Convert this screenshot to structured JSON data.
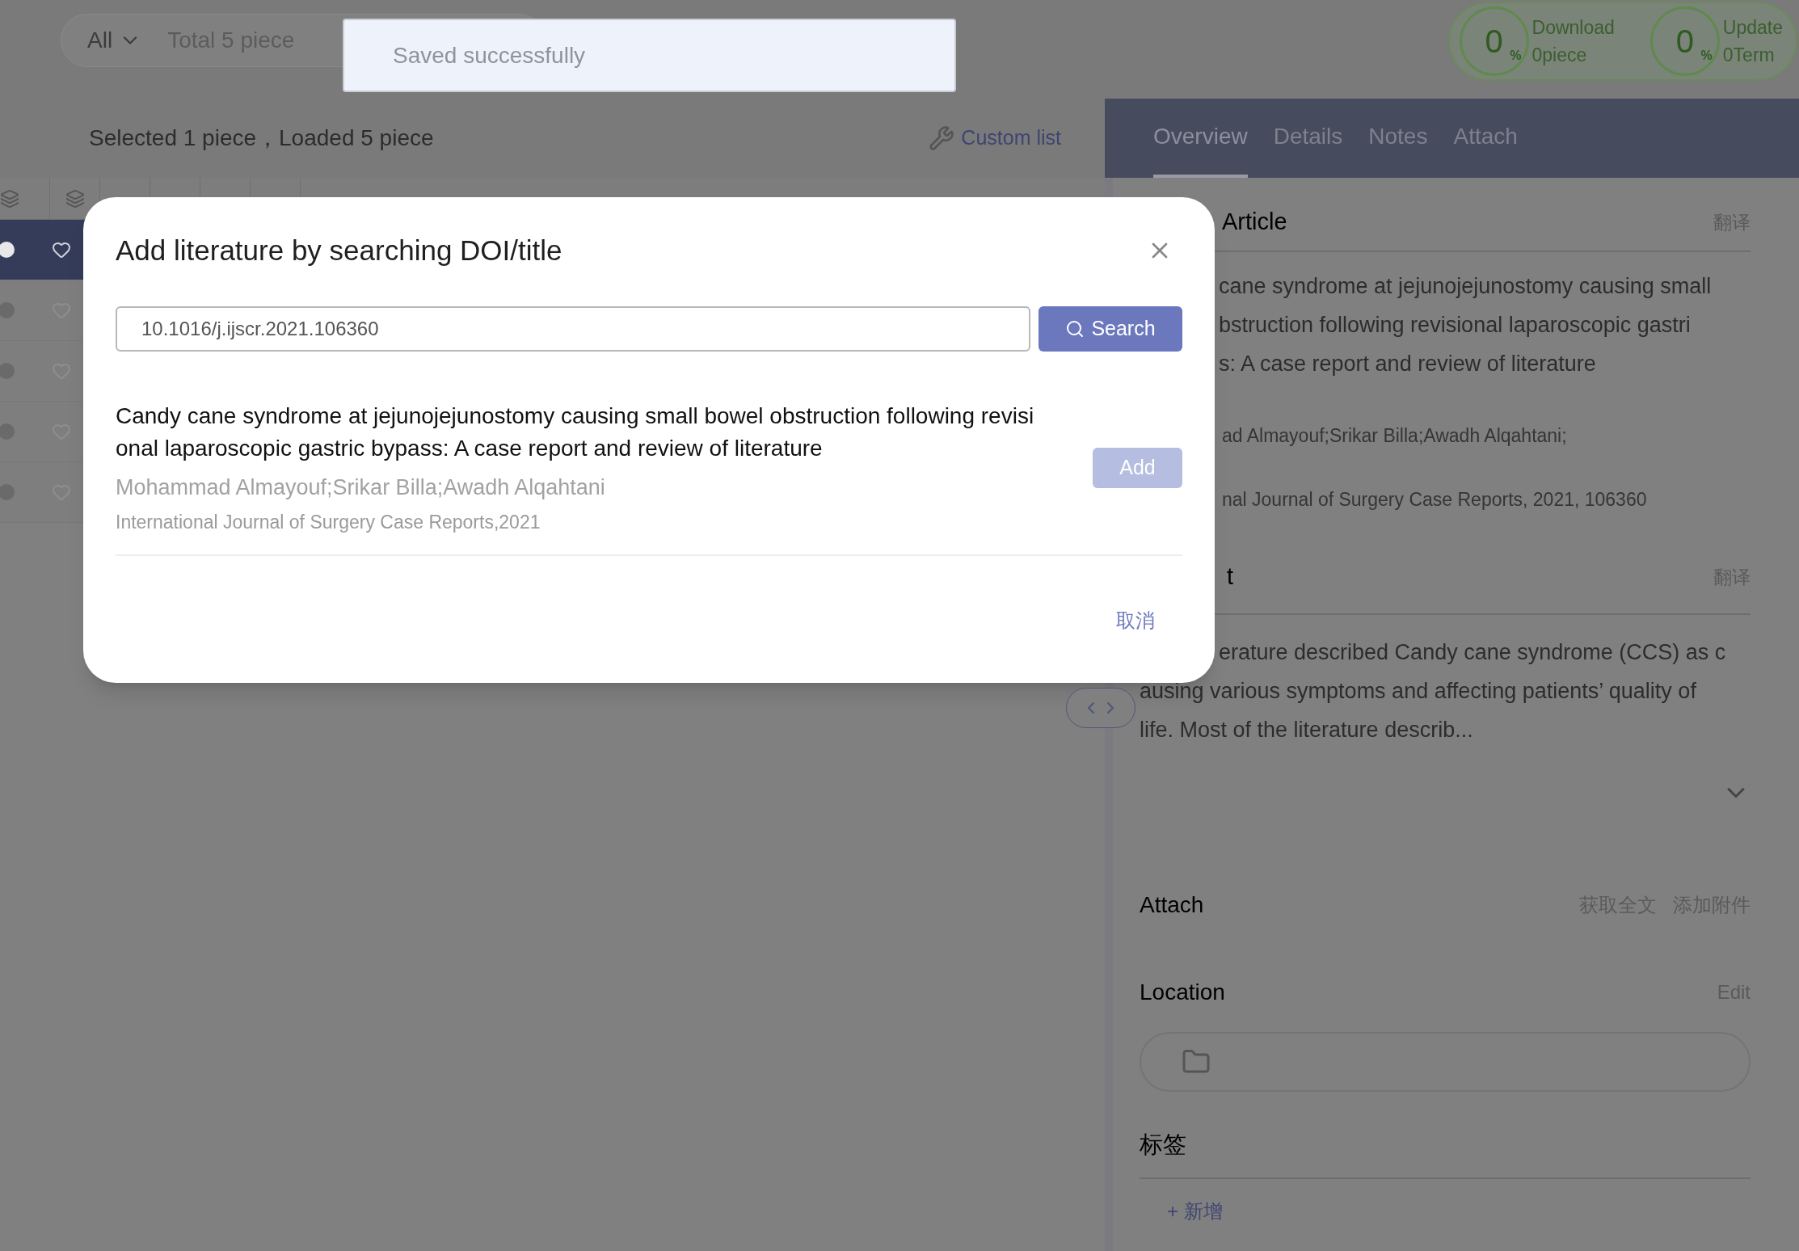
{
  "filter": {
    "scope": "All",
    "total": "Total 5 piece"
  },
  "toast": {
    "message": "Saved successfully"
  },
  "progress": [
    {
      "value": "0",
      "unit": "%",
      "label": "Download",
      "count": "0piece"
    },
    {
      "value": "0",
      "unit": "%",
      "label": "Update",
      "count": "0Term"
    }
  ],
  "list": {
    "summary": "Selected 1 piece，Loaded 5 piece",
    "custom_list": "Custom list",
    "rows": [
      {
        "selected": true
      },
      {
        "selected": false
      },
      {
        "selected": false
      },
      {
        "selected": false
      },
      {
        "selected": false
      }
    ]
  },
  "tabs": [
    {
      "label": "Overview",
      "selected": true
    },
    {
      "label": "Details",
      "selected": false
    },
    {
      "label": "Notes",
      "selected": false
    },
    {
      "label": "Attach",
      "selected": false
    }
  ],
  "overview": {
    "heading": "Article",
    "translate": "翻译",
    "title_lines": [
      "cane syndrome at jejunojejunostomy causing small",
      "bstruction following revisional laparoscopic gastri",
      "s: A case report and review of literature"
    ],
    "authors": "ad Almayouf;Srikar Billa;Awadh Alqahtani;",
    "source": "nal Journal of Surgery Case Reports, 2021, 106360",
    "abstract_heading": "t",
    "abstract_translate": "翻译",
    "abstract_lines": [
      "erature described Candy cane syndrome (CCS) as c",
      "ausing various symptoms and affecting patients’ quality of",
      "life. Most of the literature describ..."
    ],
    "attach": {
      "heading": "Attach",
      "actions": [
        "获取全文",
        "添加附件"
      ]
    },
    "location": {
      "heading": "Location",
      "edit": "Edit"
    },
    "tags": {
      "heading": "标签",
      "add": "+ 新增"
    }
  },
  "dialog": {
    "title": "Add literature by searching DOI/title",
    "query": "10.1016/j.ijscr.2021.106360",
    "search": "Search",
    "result": {
      "title": "Candy cane syndrome at jejunojejunostomy causing small bowel obstruction following revisi\nonal laparoscopic gastric bypass: A case report and review of literature",
      "authors": "Mohammad Almayouf;Srikar Billa;Awadh Alqahtani",
      "source": "International Journal of Surgery Case Reports,2021",
      "add": "Add",
      "disabled": true
    },
    "cancel": "取消"
  }
}
